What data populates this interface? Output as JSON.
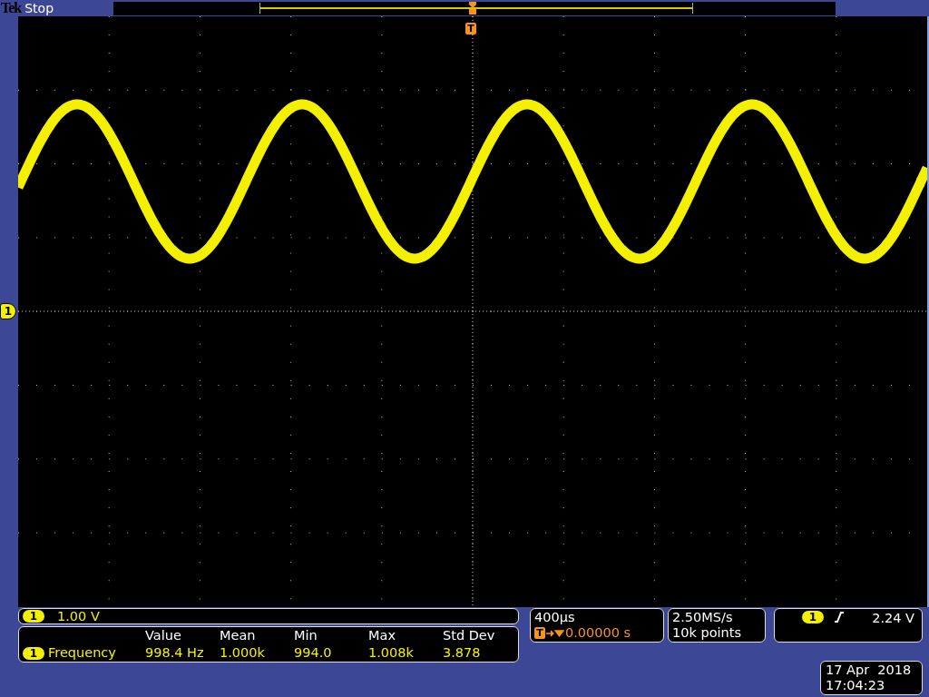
{
  "header": {
    "logo": "Tek",
    "run_state": "Stop"
  },
  "display": {
    "channel_marker": "1",
    "trigger_marker": "T"
  },
  "channel": {
    "badge": "1",
    "scale": "1.00 V"
  },
  "measurements": {
    "columns": [
      "Value",
      "Mean",
      "Min",
      "Max",
      "Std Dev"
    ],
    "rows": [
      {
        "badge": "1",
        "name": "Frequency",
        "values": [
          "998.4 Hz",
          "1.000k",
          "994.0",
          "1.008k",
          "3.878"
        ]
      }
    ]
  },
  "timebase": {
    "scale": "400µs",
    "badge": "T",
    "position": "0.00000 s"
  },
  "acquisition": {
    "rate": "2.50MS/s",
    "length": "10k points"
  },
  "trigger": {
    "badge": "1",
    "level": "2.24 V"
  },
  "datetime": {
    "date": "17 Apr  2018",
    "time": "17:04:23"
  }
}
